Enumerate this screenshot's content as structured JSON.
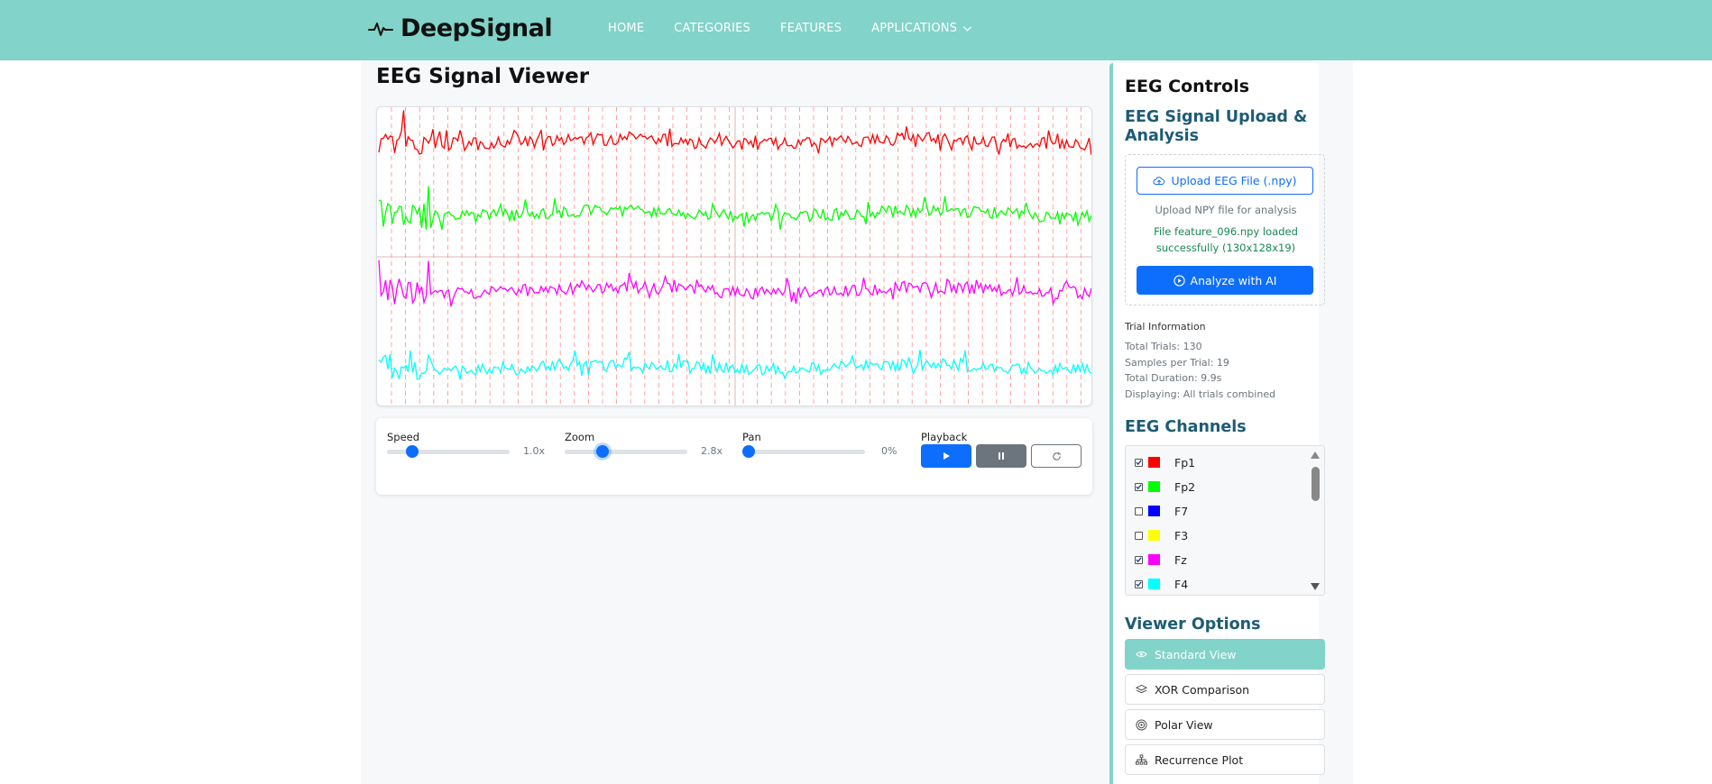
{
  "brand": {
    "name": "DeepSignal"
  },
  "nav": {
    "items": [
      {
        "label": "HOME"
      },
      {
        "label": "CATEGORIES"
      },
      {
        "label": "FEATURES"
      },
      {
        "label": "APPLICATIONS"
      }
    ]
  },
  "viewer": {
    "title": "EEG Signal Viewer",
    "signals": [
      {
        "name": "Fp1",
        "color": "#ff0000"
      },
      {
        "name": "Fp2",
        "color": "#00ff00"
      },
      {
        "name": "Fz",
        "color": "#ff00ff"
      },
      {
        "name": "F4",
        "color": "#00ffff"
      }
    ],
    "grid_color": "#ff8c8c"
  },
  "controls": {
    "speed": {
      "label": "Speed",
      "value": "1.0x",
      "fraction": 0.17
    },
    "zoom": {
      "label": "Zoom",
      "value": "2.8x",
      "fraction": 0.29
    },
    "pan": {
      "label": "Pan",
      "value": "0%",
      "fraction": 0.0
    },
    "playback": {
      "label": "Playback"
    }
  },
  "sidebar": {
    "title": "EEG Controls",
    "upload_title": "EEG Signal Upload & Analysis",
    "upload_button": "Upload EEG File (.npy)",
    "upload_hint": "Upload NPY file for analysis",
    "upload_status": "File feature_096.npy loaded successfully (130x128x19)",
    "analyze_button": "Analyze with AI",
    "trial": {
      "heading": "Trial Information",
      "lines": [
        "Total Trials: 130",
        "Samples per Trial: 19",
        "Total Duration: 9.9s",
        "Displaying: All trials combined"
      ]
    },
    "channels_title": "EEG Channels",
    "channels": [
      {
        "label": "Fp1",
        "checked": true,
        "color": "#ff0000"
      },
      {
        "label": "Fp2",
        "checked": true,
        "color": "#00ff00"
      },
      {
        "label": "F7",
        "checked": false,
        "color": "#0000ff"
      },
      {
        "label": "F3",
        "checked": false,
        "color": "#ffff00"
      },
      {
        "label": "Fz",
        "checked": true,
        "color": "#ff00ff"
      },
      {
        "label": "F4",
        "checked": true,
        "color": "#00ffff"
      }
    ],
    "viewer_options_title": "Viewer Options",
    "viewer_options": [
      {
        "label": "Standard View",
        "icon": "eye-icon",
        "active": true
      },
      {
        "label": "XOR Comparison",
        "icon": "layers-icon",
        "active": false
      },
      {
        "label": "Polar View",
        "icon": "target-icon",
        "active": false
      },
      {
        "label": "Recurrence Plot",
        "icon": "sitemap-icon",
        "active": false
      }
    ]
  },
  "colors": {
    "accent": "#82d3c9",
    "primary": "#0d6efd",
    "heading": "#1d5c74",
    "success": "#198754"
  }
}
